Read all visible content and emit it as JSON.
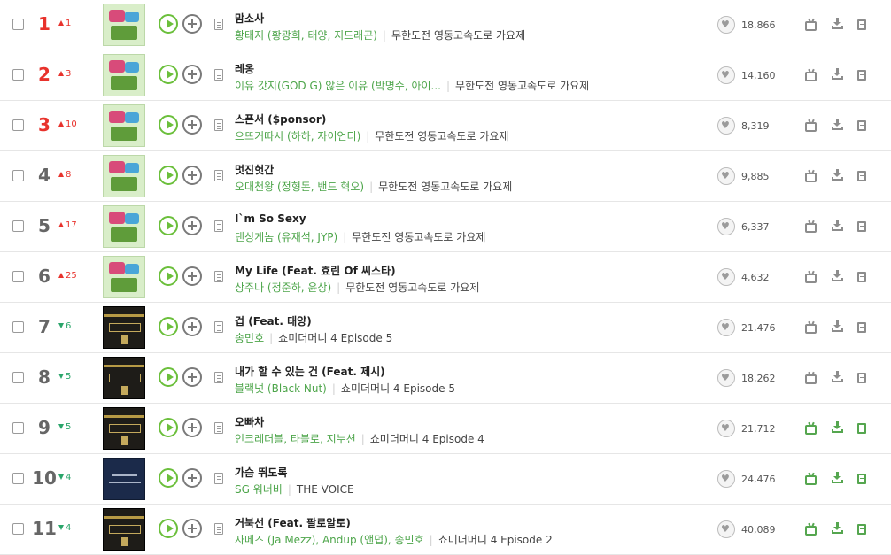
{
  "chart": {
    "rows": [
      {
        "rank": "1",
        "change": "1",
        "change_dir": "up",
        "cover": "muhan",
        "title": "맘소사",
        "artist": "황태지 (황광희, 태양, 지드래곤)",
        "album": "무한도전 영동고속도로 가요제",
        "likes": "18,866",
        "icons_on": false
      },
      {
        "rank": "2",
        "change": "3",
        "change_dir": "up",
        "cover": "muhan",
        "title": "레옹",
        "artist": "이유 갓지(GOD G) 않은 이유 (박명수, 아이...",
        "album": "무한도전 영동고속도로 가요제",
        "likes": "14,160",
        "icons_on": false
      },
      {
        "rank": "3",
        "change": "10",
        "change_dir": "up",
        "cover": "muhan",
        "title": "스폰서 ($ponsor)",
        "artist": "으뜨거따시 (하하, 자이언티)",
        "album": "무한도전 영동고속도로 가요제",
        "likes": "8,319",
        "icons_on": false
      },
      {
        "rank": "4",
        "change": "8",
        "change_dir": "up",
        "cover": "muhan",
        "title": "멋진헛간",
        "artist": "오대천왕 (정형돈, 밴드 혁오)",
        "album": "무한도전 영동고속도로 가요제",
        "likes": "9,885",
        "icons_on": false
      },
      {
        "rank": "5",
        "change": "17",
        "change_dir": "up",
        "cover": "muhan",
        "title": "I`m So Sexy",
        "artist": "댄싱게놈 (유재석, JYP)",
        "album": "무한도전 영동고속도로 가요제",
        "likes": "6,337",
        "icons_on": false
      },
      {
        "rank": "6",
        "change": "25",
        "change_dir": "up",
        "cover": "muhan",
        "title": "My Life (Feat. 효린 Of 씨스타)",
        "artist": "상주나 (정준하, 윤상)",
        "album": "무한도전 영동고속도로 가요제",
        "likes": "4,632",
        "icons_on": false
      },
      {
        "rank": "7",
        "change": "6",
        "change_dir": "down",
        "cover": "smtm",
        "title": "겁 (Feat. 태양)",
        "artist": "송민호",
        "album": "쇼미더머니 4 Episode 5",
        "likes": "21,476",
        "icons_on": false
      },
      {
        "rank": "8",
        "change": "5",
        "change_dir": "down",
        "cover": "smtm",
        "title": "내가 할 수 있는 건 (Feat. 제시)",
        "artist": "블랙넛 (Black Nut)",
        "album": "쇼미더머니 4 Episode 5",
        "likes": "18,262",
        "icons_on": false
      },
      {
        "rank": "9",
        "change": "5",
        "change_dir": "down",
        "cover": "smtm",
        "title": "오빠차",
        "artist": "인크레더블, 타블로, 지누션",
        "album": "쇼미더머니 4 Episode 4",
        "likes": "21,712",
        "icons_on": true
      },
      {
        "rank": "10",
        "change": "4",
        "change_dir": "down",
        "cover": "sg",
        "title": "가슴 뛰도록",
        "artist": "SG 워너비",
        "album": "THE VOICE",
        "likes": "24,476",
        "icons_on": true
      },
      {
        "rank": "11",
        "change": "4",
        "change_dir": "down",
        "cover": "smtm",
        "title": "거북선 (Feat. 팔로알토)",
        "artist": "자메즈 (Ja Mezz), Andup (앤덥), 송민호",
        "album": "쇼미더머니 4 Episode 2",
        "likes": "40,089",
        "icons_on": true
      }
    ],
    "colors": {
      "top_rank": "#e8322c",
      "up": "#e8322c",
      "down": "#2aa56a",
      "artist": "#4da54a",
      "accent": "#6bbf3b",
      "icon_active": "#55a64f",
      "icon_inactive": "#8c8c8c"
    },
    "icons": {
      "play": "play-icon",
      "add": "add-icon",
      "lyrics": "lyrics-icon",
      "like": "heart-icon",
      "mv": "mv-icon",
      "download": "download-icon",
      "ringtone": "ringtone-icon"
    }
  }
}
